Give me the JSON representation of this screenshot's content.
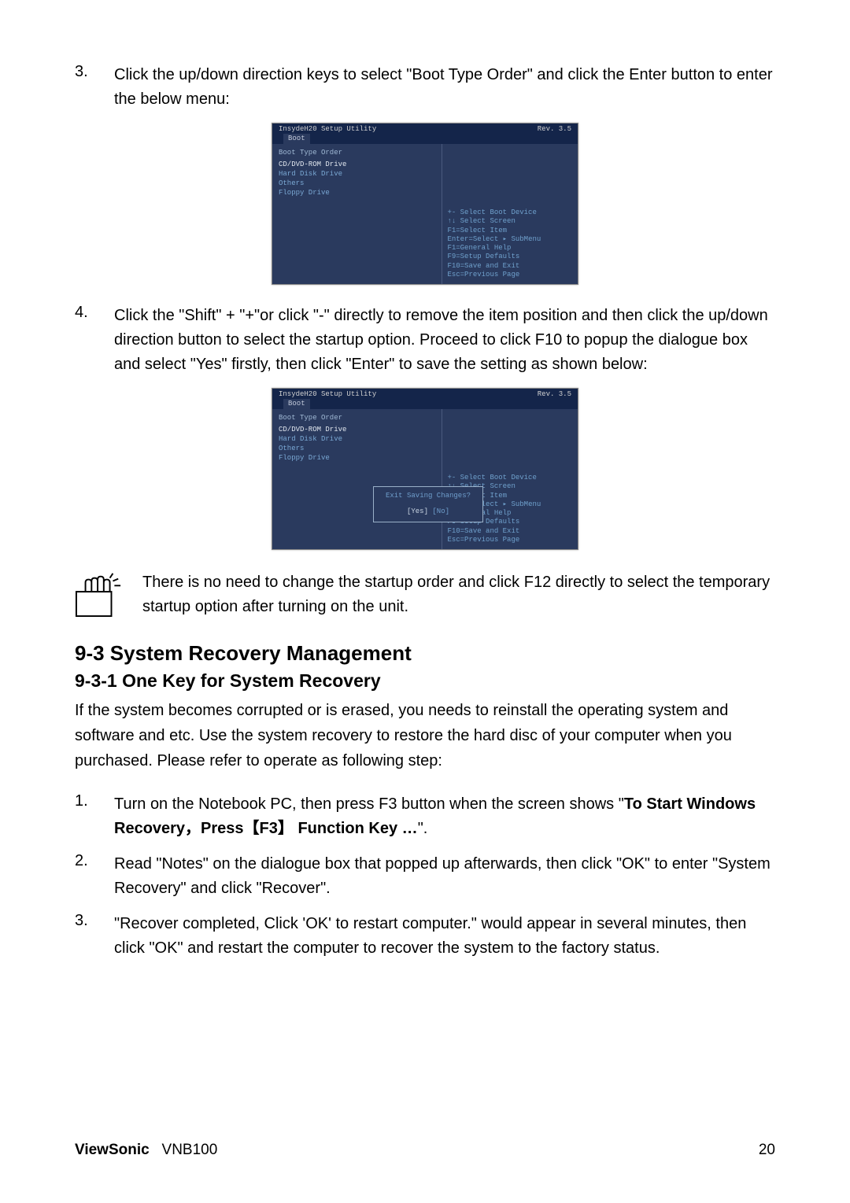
{
  "step3": {
    "num": "3.",
    "text": "Click the up/down direction keys to select \"Boot Type Order\" and click the Enter button to enter the below menu:"
  },
  "bios1": {
    "title": "InsydeH20 Setup Utility",
    "rev": "Rev. 3.5",
    "tab": "Boot",
    "heading": "Boot Type Order",
    "items": [
      "CD/DVD-ROM Drive",
      "Hard Disk Drive",
      "Others",
      "Floppy Drive"
    ],
    "help": [
      "+-   Select Boot Device",
      "↑↓   Select Screen",
      "F1=Select Item",
      "Enter=Select ▸ SubMenu",
      "F1=General Help",
      "F9=Setup Defaults",
      "F10=Save and Exit",
      "Esc=Previous Page"
    ]
  },
  "step4": {
    "num": "4.",
    "text": "Click the \"Shift\" + \"+\"or click \"-\" directly to remove the item position and then click the up/down direction button to select the startup option. Proceed to click F10 to popup the dialogue box and select \"Yes\" firstly, then click \"Enter\" to save the setting as shown below:"
  },
  "bios2": {
    "title": "InsydeH20 Setup Utility",
    "rev": "Rev. 3.5",
    "tab": "Boot",
    "heading": "Boot Type Order",
    "items": [
      "CD/DVD-ROM Drive",
      "Hard Disk Drive",
      "Others",
      "Floppy Drive"
    ],
    "dialog_q": "Exit Saving Changes?",
    "dialog_yes": "[Yes]",
    "dialog_no": "[No]",
    "help": [
      "+-   Select Boot Device",
      "↑↓   Select Screen",
      "F1=Select Item",
      "Enter=Select ▸ SubMenu",
      "F1=General Help",
      "F9=Setup Defaults",
      "F10=Save and Exit",
      "Esc=Previous Page"
    ]
  },
  "tip": "There is no need to change the startup order and click F12 directly to select the temporary startup option after turning on the unit.",
  "h2": "9-3 System Recovery Management",
  "h3": "9-3-1 One Key for System Recovery",
  "intro": "If the system becomes corrupted or is erased, you needs to reinstall the operating system and software and etc. Use the system recovery to restore the hard disc of your computer when you purchased. Please refer to operate as following step:",
  "r1": {
    "num": "1.",
    "pre": "Turn on the Notebook PC, then press F3 button when the screen shows \"",
    "bold": "To Start Windows Recovery，Press【F3】 Function Key …",
    "post": "\"."
  },
  "r2": {
    "num": "2.",
    "text": "Read \"Notes\" on the dialogue box that popped up afterwards, then click \"OK\" to enter \"System Recovery\" and click \"Recover\"."
  },
  "r3": {
    "num": "3.",
    "text": "\"Recover completed, Click 'OK' to restart computer.\" would appear in several minutes, then click \"OK\" and restart the computer to recover the system to the factory status."
  },
  "footer": {
    "brand": "ViewSonic",
    "model": "VNB100",
    "page": "20"
  }
}
